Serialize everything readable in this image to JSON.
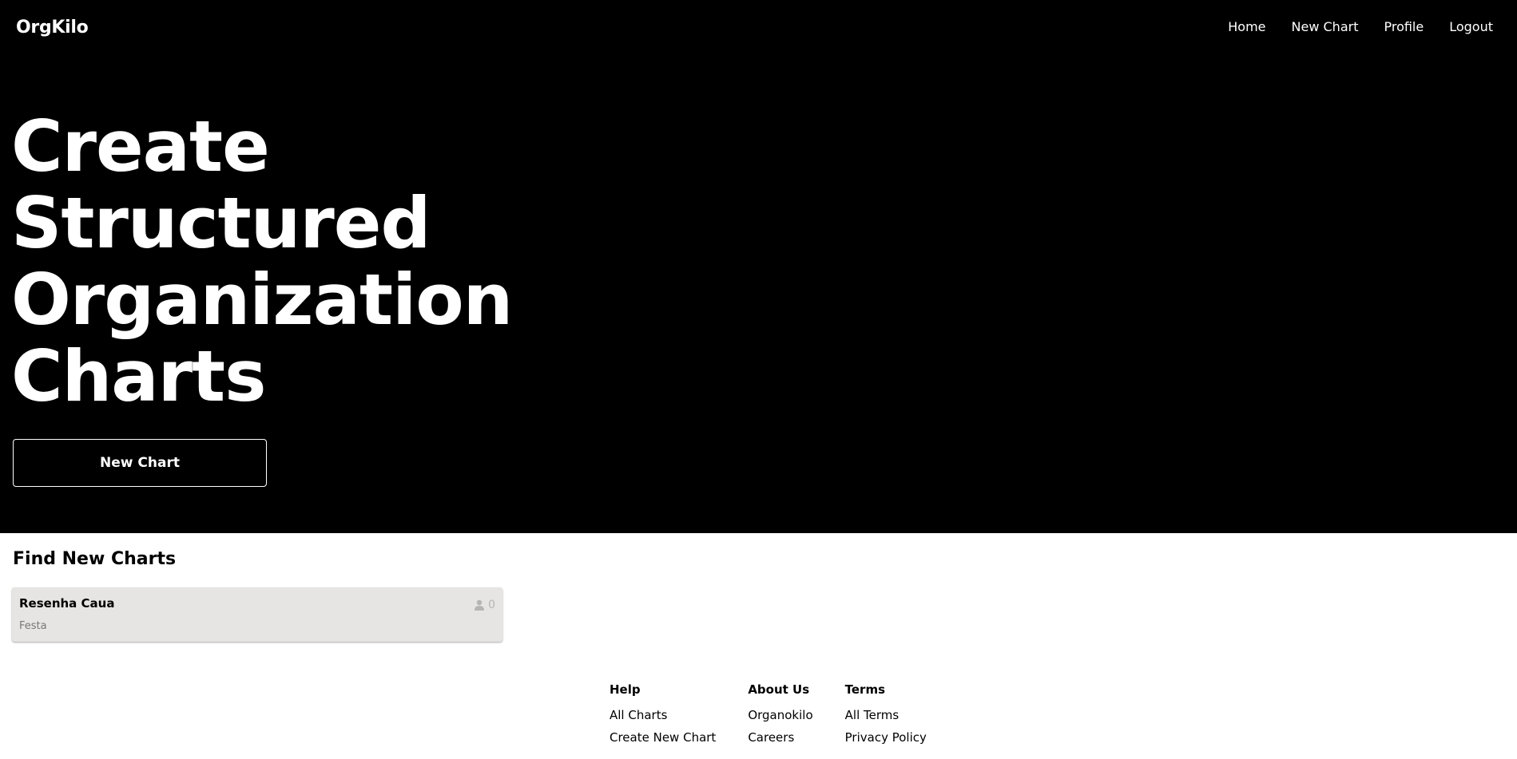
{
  "header": {
    "logo": "OrgKilo",
    "nav": [
      "Home",
      "New Chart",
      "Profile",
      "Logout"
    ]
  },
  "hero": {
    "headline_lines": [
      "Create",
      "Structured",
      "Organization",
      "Charts"
    ],
    "cta_label": "New Chart"
  },
  "find_section": {
    "title": "Find New Charts",
    "cards": [
      {
        "title": "Resenha Caua",
        "subtitle": "Festa",
        "member_count": "0",
        "icon": "user-icon"
      }
    ]
  },
  "footer": {
    "columns": [
      {
        "heading": "Help",
        "links": [
          "All Charts",
          "Create New Chart"
        ]
      },
      {
        "heading": "About Us",
        "links": [
          "Organokilo",
          "Careers"
        ]
      },
      {
        "heading": "Terms",
        "links": [
          "All Terms",
          "Privacy Policy"
        ]
      }
    ]
  },
  "colors": {
    "hero_background": "#000000",
    "card_background": "#e7e5e3",
    "text_light": "#ffffff"
  }
}
